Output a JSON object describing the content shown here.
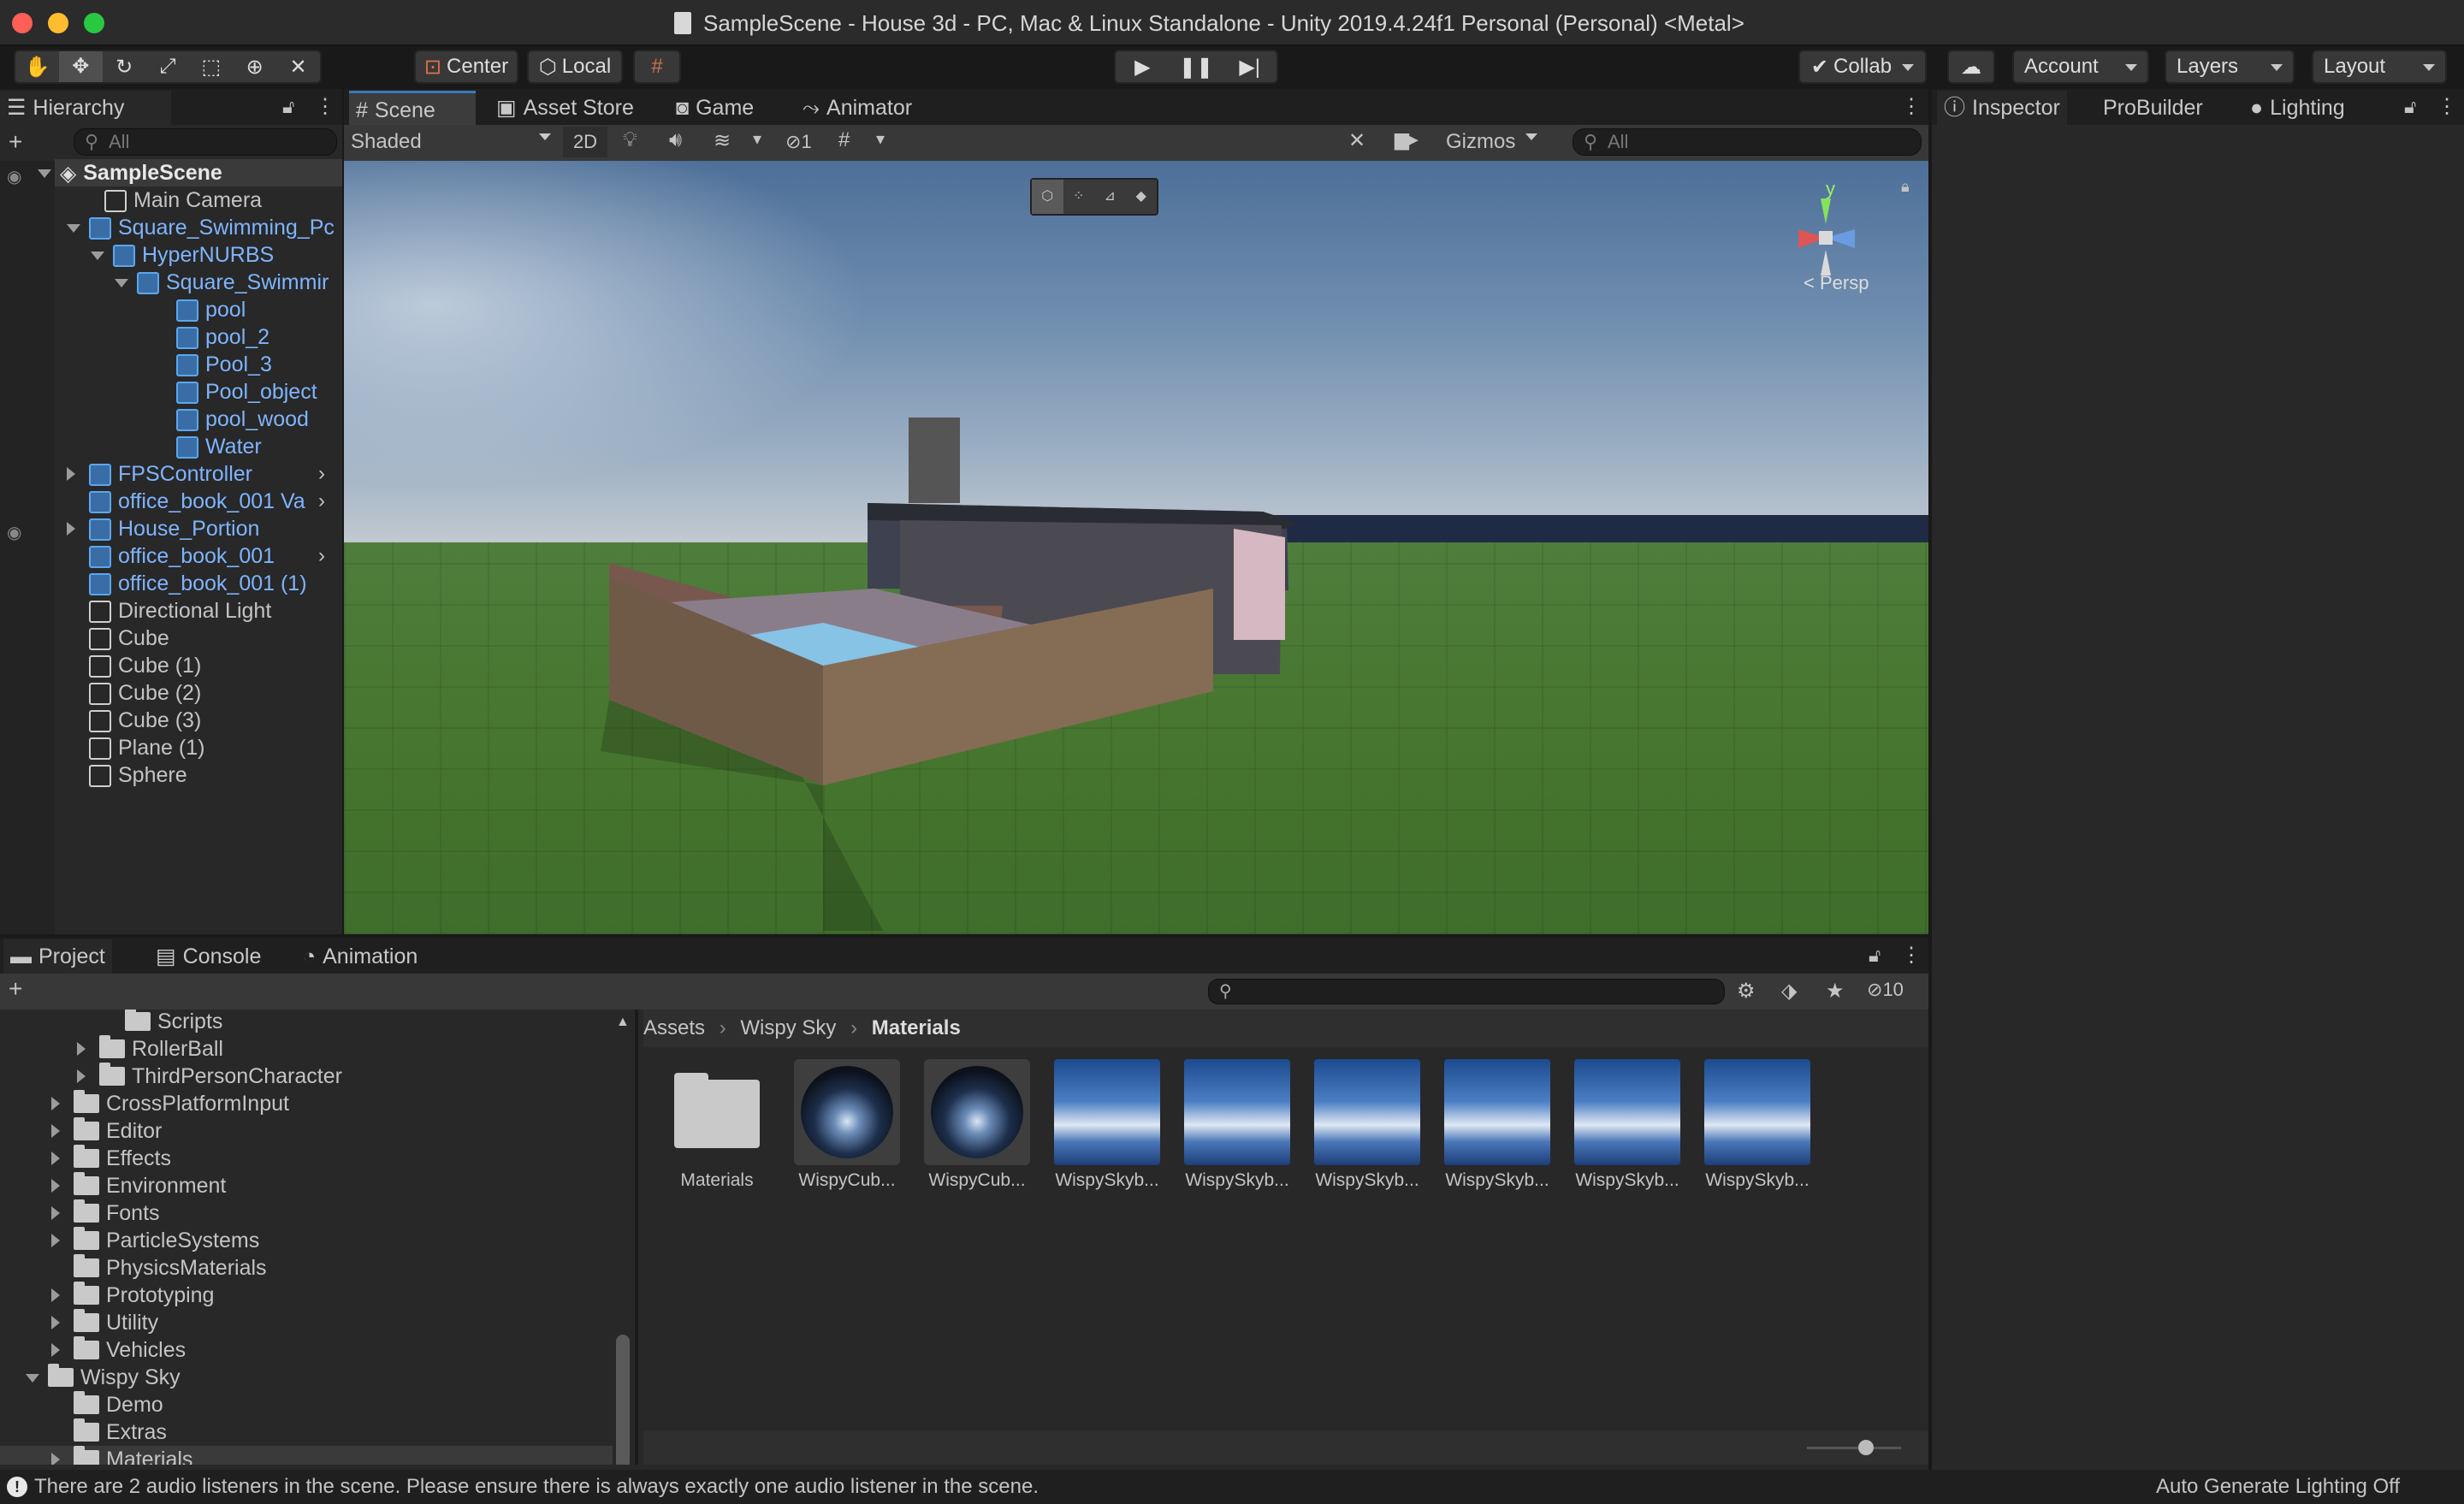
{
  "window": {
    "title": "SampleScene - House 3d - PC, Mac & Linux Standalone - Unity 2019.4.24f1 Personal (Personal) <Metal>"
  },
  "toolbar": {
    "pivot": "Center",
    "space": "Local",
    "collab": "Collab",
    "account": "Account",
    "layers": "Layers",
    "layout": "Layout"
  },
  "colors": {
    "accent": "#3a79bb",
    "selection": "#2c5d87",
    "link": "#7eb4ff",
    "panel": "#282828"
  },
  "hierarchy": {
    "tab": "Hierarchy",
    "search_placeholder": "All",
    "items": [
      {
        "label": "SampleScene",
        "kind": "scene"
      },
      {
        "label": "Main Camera",
        "kind": "object"
      },
      {
        "label": "Square_Swimming_Pc",
        "kind": "prefab"
      },
      {
        "label": "HyperNURBS",
        "kind": "prefab"
      },
      {
        "label": "Square_Swimmir",
        "kind": "prefab"
      },
      {
        "label": "pool",
        "kind": "prefab"
      },
      {
        "label": "pool_2",
        "kind": "prefab"
      },
      {
        "label": "Pool_3",
        "kind": "prefab"
      },
      {
        "label": "Pool_object",
        "kind": "prefab"
      },
      {
        "label": "pool_wood",
        "kind": "prefab"
      },
      {
        "label": "Water",
        "kind": "prefab"
      },
      {
        "label": "FPSController",
        "kind": "prefab"
      },
      {
        "label": "office_book_001 Va",
        "kind": "prefab"
      },
      {
        "label": "House_Portion",
        "kind": "prefab"
      },
      {
        "label": "office_book_001",
        "kind": "prefab"
      },
      {
        "label": "office_book_001 (1)",
        "kind": "prefab"
      },
      {
        "label": "Directional Light",
        "kind": "object"
      },
      {
        "label": "Cube",
        "kind": "object"
      },
      {
        "label": "Cube (1)",
        "kind": "object"
      },
      {
        "label": "Cube (2)",
        "kind": "object"
      },
      {
        "label": "Cube (3)",
        "kind": "object"
      },
      {
        "label": "Plane (1)",
        "kind": "object"
      },
      {
        "label": "Sphere",
        "kind": "object"
      }
    ]
  },
  "scene_tabs": [
    "Scene",
    "Asset Store",
    "Game",
    "Animator"
  ],
  "scene_toolbar": {
    "shading": "Shaded",
    "mode_2d": "2D",
    "hidden_count": "1",
    "gizmos": "Gizmos",
    "search_placeholder": "All"
  },
  "gizmo": {
    "axis_y": "y",
    "projection": "Persp"
  },
  "inspector_tabs": [
    "Inspector",
    "ProBuilder",
    "Lighting"
  ],
  "bottom_tabs": [
    "Project",
    "Console",
    "Animation"
  ],
  "project": {
    "badge_count": "10",
    "breadcrumb": [
      "Assets",
      "Wispy Sky",
      "Materials"
    ],
    "folders": [
      {
        "label": "Scripts"
      },
      {
        "label": "RollerBall"
      },
      {
        "label": "ThirdPersonCharacter"
      },
      {
        "label": "CrossPlatformInput"
      },
      {
        "label": "Editor"
      },
      {
        "label": "Effects"
      },
      {
        "label": "Environment"
      },
      {
        "label": "Fonts"
      },
      {
        "label": "ParticleSystems"
      },
      {
        "label": "PhysicsMaterials"
      },
      {
        "label": "Prototyping"
      },
      {
        "label": "Utility"
      },
      {
        "label": "Vehicles"
      },
      {
        "label": "Wispy Sky"
      },
      {
        "label": "Demo"
      },
      {
        "label": "Extras"
      },
      {
        "label": "Materials"
      }
    ],
    "assets": [
      {
        "label": "Materials",
        "kind": "folder"
      },
      {
        "label": "WispyCub...",
        "kind": "cubemap"
      },
      {
        "label": "WispyCub...",
        "kind": "cubemap"
      },
      {
        "label": "WispySkyb...",
        "kind": "skybox"
      },
      {
        "label": "WispySkyb...",
        "kind": "skybox"
      },
      {
        "label": "WispySkyb...",
        "kind": "skybox"
      },
      {
        "label": "WispySkyb...",
        "kind": "skybox"
      },
      {
        "label": "WispySkyb...",
        "kind": "skybox"
      },
      {
        "label": "WispySkyb...",
        "kind": "skybox"
      }
    ]
  },
  "status": {
    "message": "There are 2 audio listeners in the scene. Please ensure there is always exactly one audio listener in the scene.",
    "lighting": "Auto Generate Lighting Off"
  }
}
